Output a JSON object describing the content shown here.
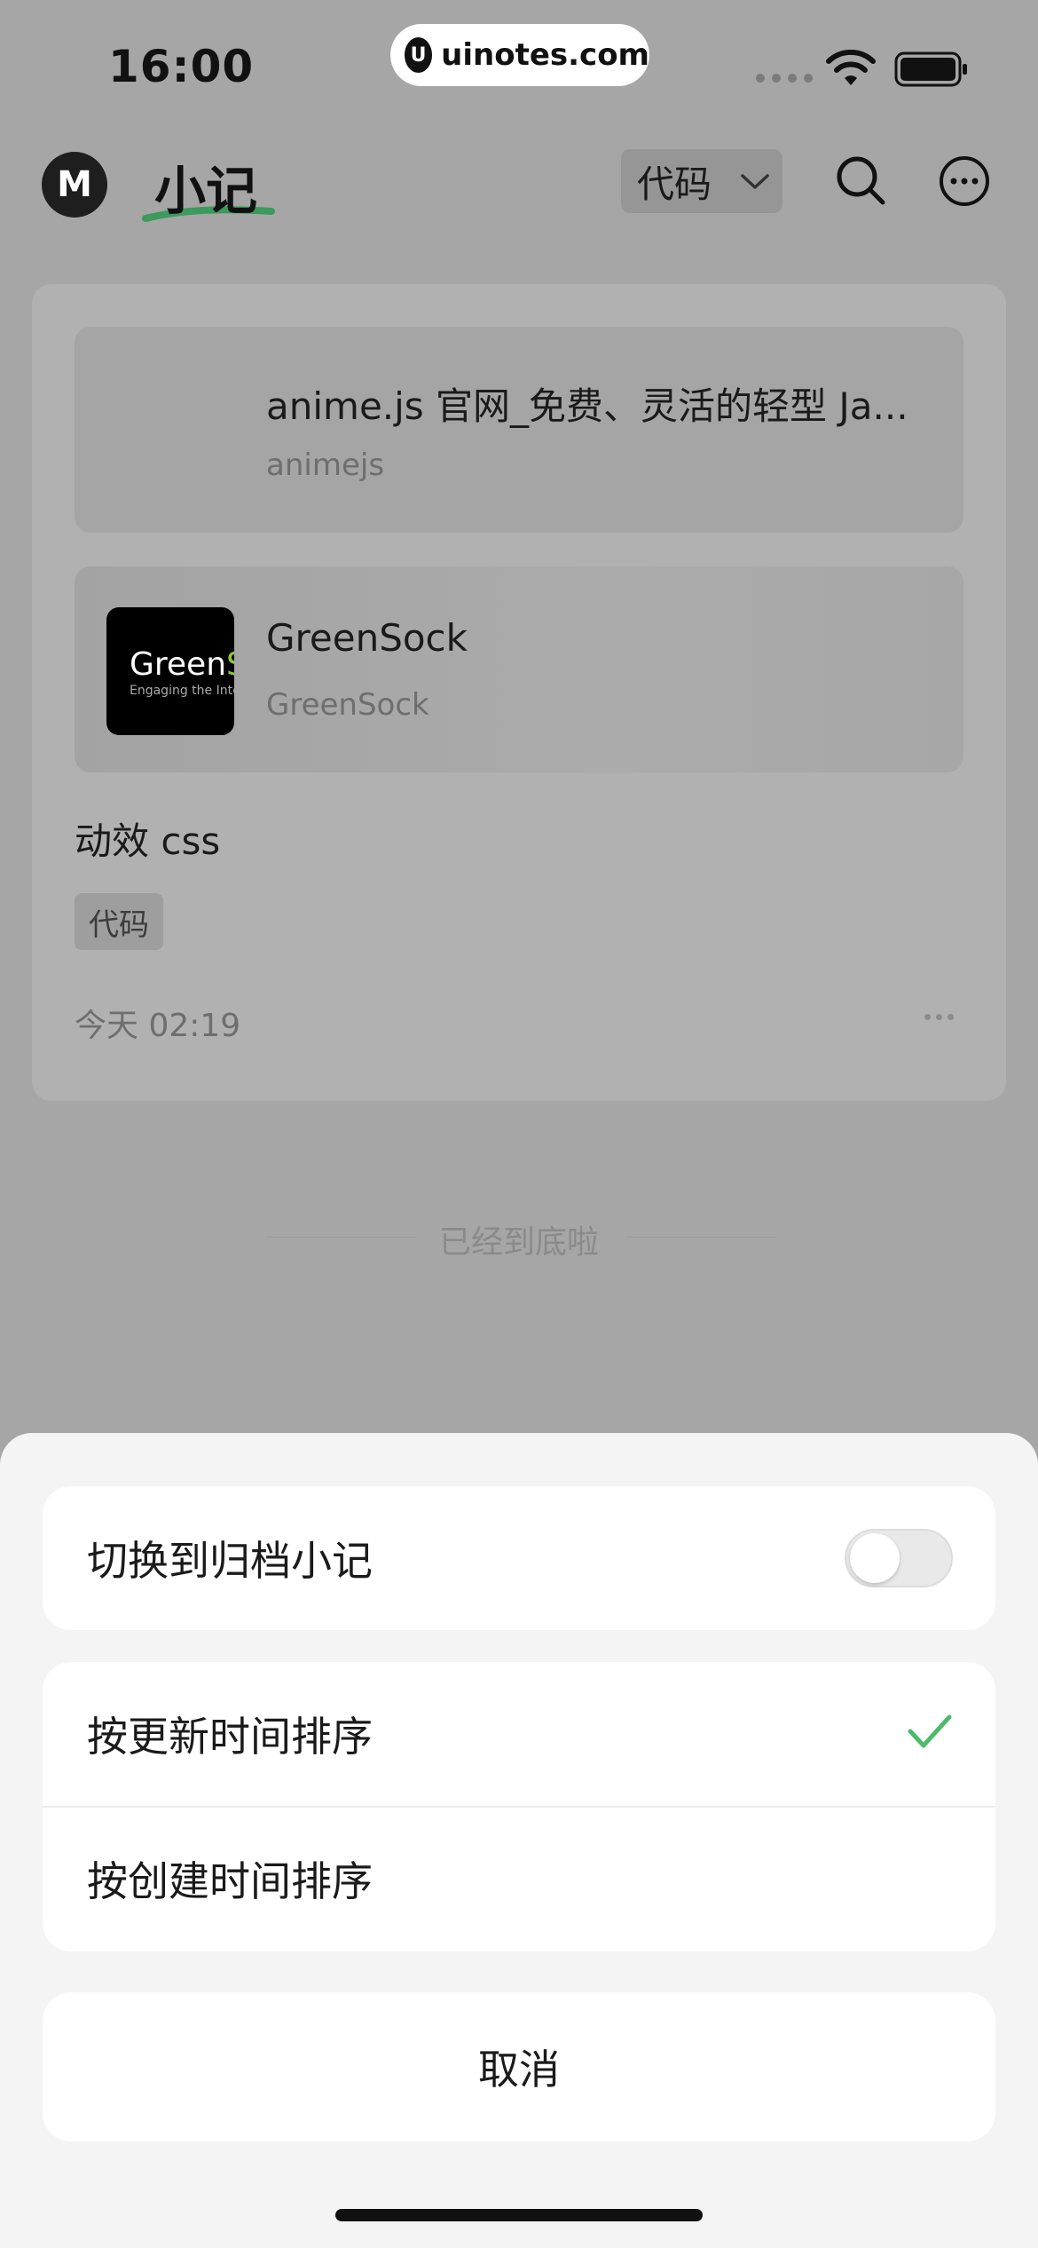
{
  "status_bar": {
    "time": "16:00",
    "watermark": "uinotes.com",
    "watermark_logo": "U"
  },
  "header": {
    "logo_letter": "M",
    "title": "小记",
    "filter_label": "代码",
    "icons": {
      "filter": "chevron-down-icon",
      "search": "search-icon",
      "more": "more-icon"
    }
  },
  "note": {
    "links": [
      {
        "title": "anime.js 官网_免费、灵活的轻型 Ja...",
        "source": "animejs",
        "has_thumb": false
      },
      {
        "title": "GreenSock",
        "source": "GreenSock",
        "has_thumb": true,
        "thumb_text_main": "Green",
        "thumb_text_accent": "So",
        "thumb_subtext": "Engaging the Interne"
      }
    ],
    "text": "动效 css",
    "tag": "代码",
    "date": "今天 02:19"
  },
  "list_end_label": "已经到底啦",
  "sheet": {
    "archive_label": "切换到归档小记",
    "archive_toggle_on": false,
    "sort_options": [
      {
        "label": "按更新时间排序",
        "selected": true
      },
      {
        "label": "按创建时间排序",
        "selected": false
      }
    ],
    "cancel_label": "取消"
  },
  "colors": {
    "accent": "#4cba6b",
    "overlay_bg": "#a6a6a6",
    "sheet_bg": "#f4f4f4"
  }
}
